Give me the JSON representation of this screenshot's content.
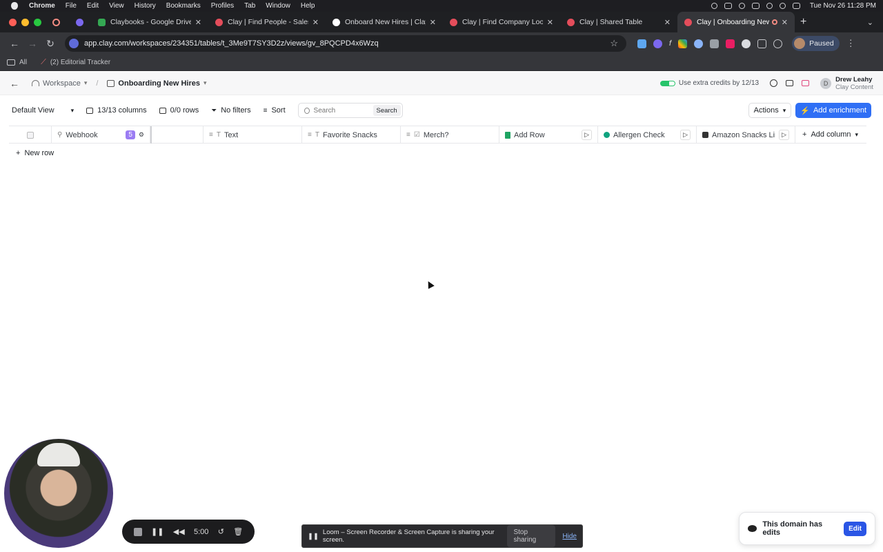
{
  "menubar": {
    "app": "Chrome",
    "items": [
      "File",
      "Edit",
      "View",
      "History",
      "Bookmarks",
      "Profiles",
      "Tab",
      "Window",
      "Help"
    ],
    "clock": "Tue Nov 26  11:28 PM"
  },
  "tabs": [
    {
      "title": "Claybooks - Google Drive",
      "favicon_color": "#34a853"
    },
    {
      "title": "Clay | Find People - Sales Na",
      "favicon_color": "#e44d5b"
    },
    {
      "title": "Onboard New Hires | Clay",
      "favicon_color": "#ffffff"
    },
    {
      "title": "Clay | Find Company Lookalik",
      "favicon_color": "#e44d5b"
    },
    {
      "title": "Clay | Shared Table",
      "favicon_color": "#e44d5b"
    },
    {
      "title": "Clay | Onboarding New Hi",
      "favicon_color": "#e44d5b",
      "active": true
    }
  ],
  "browser": {
    "url": "app.clay.com/workspaces/234351/tables/t_3Me9T7SY3D2z/views/gv_8PQCPD4x6Wzq",
    "profile_label": "Paused",
    "bookmarks": [
      "All",
      "(2) Editorial Tracker"
    ]
  },
  "app": {
    "breadcrumb_workspace": "Workspace",
    "breadcrumb_table": "Onboarding New Hires",
    "credits_text": "Use extra credits by 12/13",
    "user_initial": "D",
    "user_name": "Drew Leahy",
    "user_org": "Clay Content"
  },
  "viewbar": {
    "view": "Default View",
    "columns": "13/13 columns",
    "rows": "0/0 rows",
    "filters": "No filters",
    "sort": "Sort",
    "search_placeholder": "Search",
    "search_button": "Search",
    "actions": "Actions",
    "add_enrichment": "Add enrichment"
  },
  "columns": [
    {
      "name": "Webhook",
      "badge": "5"
    },
    {
      "name": ""
    },
    {
      "name": "Text",
      "type_icon": "T"
    },
    {
      "name": "Favorite Snacks",
      "type_icon": "T"
    },
    {
      "name": "Merch?",
      "type_icon": "☑"
    },
    {
      "name": "Add Row"
    },
    {
      "name": "Allergen Check"
    },
    {
      "name": "Amazon Snacks Link"
    }
  ],
  "add_column": "Add column",
  "new_row": "New row",
  "loom": {
    "timer": "5:00",
    "share_text": "Loom – Screen Recorder & Screen Capture is sharing your screen.",
    "stop_sharing": "Stop sharing",
    "hide": "Hide"
  },
  "toast": {
    "text": "This domain has edits",
    "edit": "Edit"
  }
}
